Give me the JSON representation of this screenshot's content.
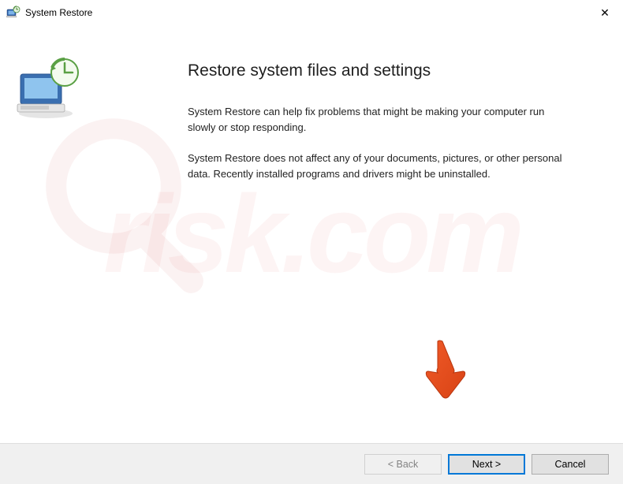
{
  "window": {
    "title": "System Restore"
  },
  "page": {
    "heading": "Restore system files and settings",
    "para1": "System Restore can help fix problems that might be making your computer run slowly or stop responding.",
    "para2": "System Restore does not affect any of your documents, pictures, or other personal data. Recently installed programs and drivers might be uninstalled."
  },
  "buttons": {
    "back": "< Back",
    "next": "Next >",
    "cancel": "Cancel"
  }
}
